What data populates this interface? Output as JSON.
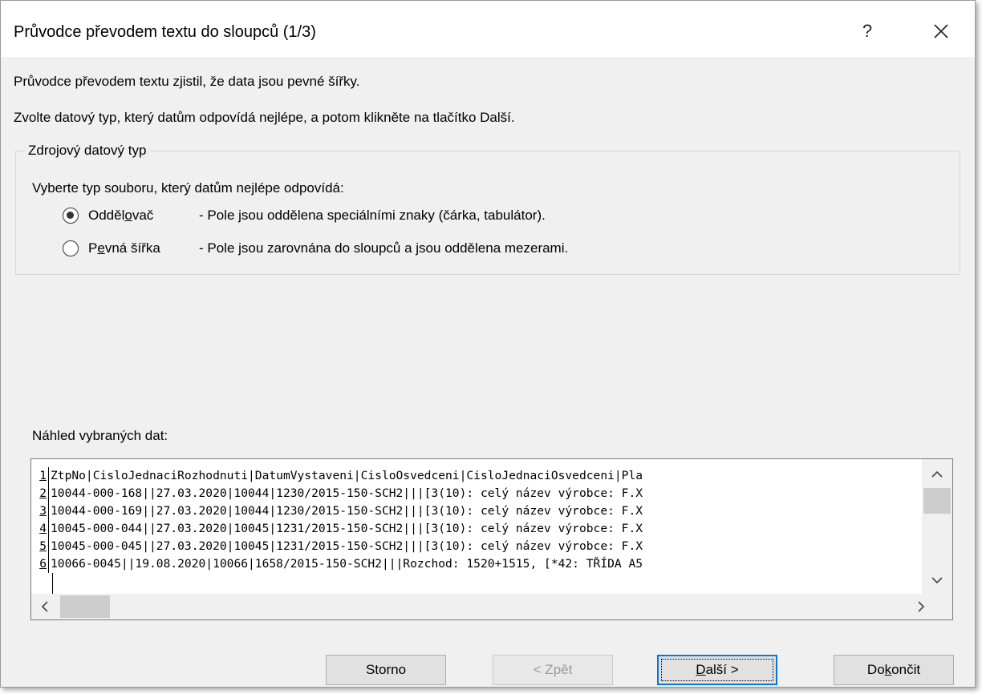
{
  "window": {
    "title": "Průvodce převodem textu do sloupců (1/3)",
    "help_label": "?"
  },
  "intro": {
    "line1": "Průvodce převodem textu zjistil, že data jsou pevné šířky.",
    "line2": "Zvolte datový typ, který datům odpovídá nejlépe, a potom klikněte na tlačítko Další."
  },
  "source_type": {
    "legend": "Zdrojový datový typ",
    "prompt": "Vyberte typ souboru, který datům nejlépe odpovídá:",
    "options": [
      {
        "label_pre": "Odděl",
        "label_key": "o",
        "label_post": "vač",
        "description": "- Pole jsou oddělena speciálními znaky (čárka, tabulátor).",
        "selected": true
      },
      {
        "label_pre": "P",
        "label_key": "e",
        "label_post": "vná šířka",
        "description": "- Pole jsou zarovnána do sloupců a jsou oddělena mezerami.",
        "selected": false
      }
    ]
  },
  "preview": {
    "label": "Náhled vybraných dat:",
    "lines": [
      {
        "num": "1",
        "text": "ZtpNo|CisloJednaciRozhodnuti|DatumVystaveni|CisloOsvedceni|CisloJednaciOsvedceni|Pla"
      },
      {
        "num": "2",
        "text": "10044-000-168||27.03.2020|10044|1230/2015-150-SCH2|||[3(10): celý název výrobce: F.X"
      },
      {
        "num": "3",
        "text": "10044-000-169||27.03.2020|10044|1230/2015-150-SCH2|||[3(10): celý název výrobce: F.X"
      },
      {
        "num": "4",
        "text": "10045-000-044||27.03.2020|10045|1231/2015-150-SCH2|||[3(10): celý název výrobce: F.X"
      },
      {
        "num": "5",
        "text": "10045-000-045||27.03.2020|10045|1231/2015-150-SCH2|||[3(10): celý název výrobce: F.X"
      },
      {
        "num": "6",
        "text": "10066-0045||19.08.2020|10066|1658/2015-150-SCH2|||Rozchod: 1520+1515, [*42: TŘÍDA A5"
      }
    ]
  },
  "buttons": {
    "cancel": "Storno",
    "back": "< Zpět",
    "next_key": "D",
    "next_post": "alší >",
    "finish_pre": "Do",
    "finish_key": "k",
    "finish_post": "ončit"
  },
  "colors": {
    "dialog_bg": "#f0f0f0",
    "accent": "#0078d7"
  }
}
